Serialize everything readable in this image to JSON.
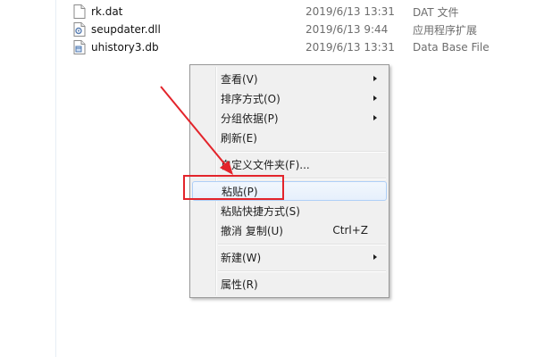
{
  "files": [
    {
      "name": "rk.dat",
      "date": "2019/6/13 13:31",
      "type": "DAT 文件",
      "icon": "blank-file-icon"
    },
    {
      "name": "seupdater.dll",
      "date": "2019/6/13 9:44",
      "type": "应用程序扩展",
      "icon": "dll-file-icon"
    },
    {
      "name": "uhistory3.db",
      "date": "2019/6/13 13:31",
      "type": "Data Base File",
      "icon": "db-file-icon"
    }
  ],
  "context_menu": {
    "view": "查看(V)",
    "sort_by": "排序方式(O)",
    "group_by": "分组依据(P)",
    "refresh": "刷新(E)",
    "customize_folder": "自定义文件夹(F)...",
    "paste": "粘贴(P)",
    "paste_shortcut": "粘贴快捷方式(S)",
    "undo_copy": "撤消 复制(U)",
    "undo_copy_shortcut": "Ctrl+Z",
    "new": "新建(W)",
    "properties": "属性(R)"
  },
  "annotation": {
    "color": "#e3242b"
  }
}
